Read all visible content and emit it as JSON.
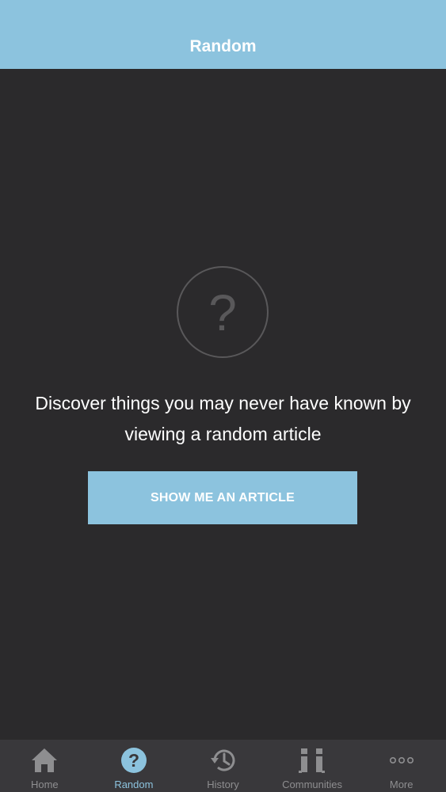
{
  "header": {
    "title": "Random"
  },
  "main": {
    "placeholder_symbol": "?",
    "message": "Discover things you may never have known by viewing a random article",
    "cta_label": "SHOW ME AN ARTICLE"
  },
  "tabbar": {
    "active": "Random",
    "tabs": [
      {
        "label": "Home",
        "icon": "home-icon"
      },
      {
        "label": "Random",
        "icon": "question-icon"
      },
      {
        "label": "History",
        "icon": "history-icon"
      },
      {
        "label": "Communities",
        "icon": "communities-icon"
      },
      {
        "label": "More",
        "icon": "more-icon"
      }
    ]
  },
  "colors": {
    "accent": "#8cc3de",
    "background": "#2b2a2c",
    "tabbar": "#39383b",
    "inactive": "#8e8e90"
  }
}
